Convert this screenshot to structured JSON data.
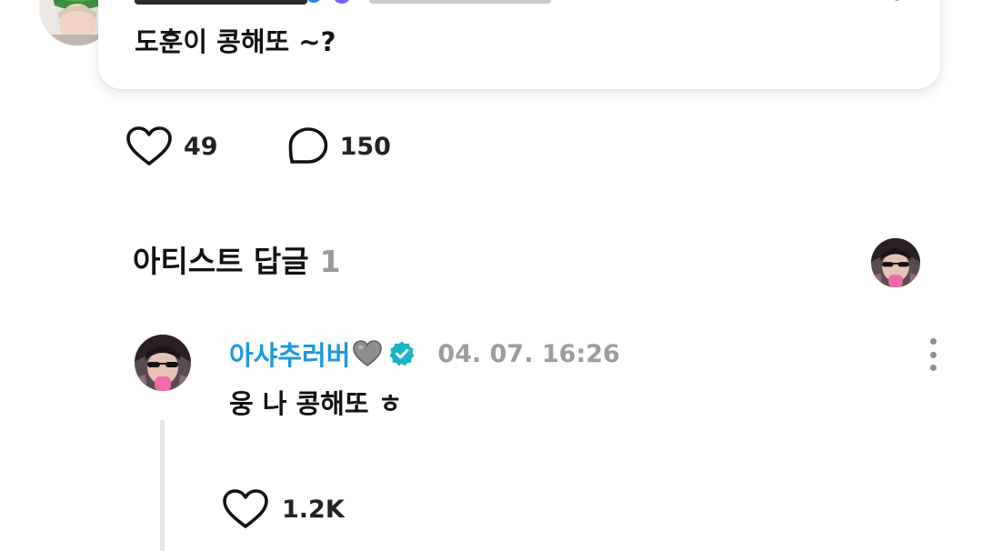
{
  "post": {
    "text": "도훈이 콩해또 ~?",
    "likes": "49",
    "comments": "150"
  },
  "artist_replies": {
    "title": "아티스트 답글",
    "count": "1"
  },
  "reply": {
    "author": "아샤추러버",
    "author_emoji": "🩶",
    "date": "04. 07. 16:26",
    "text": "웅 나 콩해또 ㅎ",
    "likes": "1.2K"
  },
  "icons": {
    "like": "heart-outline-icon",
    "comment": "speech-bubble-icon",
    "more": "vertical-dots-icon",
    "verified": "verified-badge-icon"
  },
  "colors": {
    "author_name": "#1f98d8",
    "verified_badge": "#17b5c6",
    "muted_text": "#9c9c9c",
    "count_muted": "#9a9a9a"
  }
}
